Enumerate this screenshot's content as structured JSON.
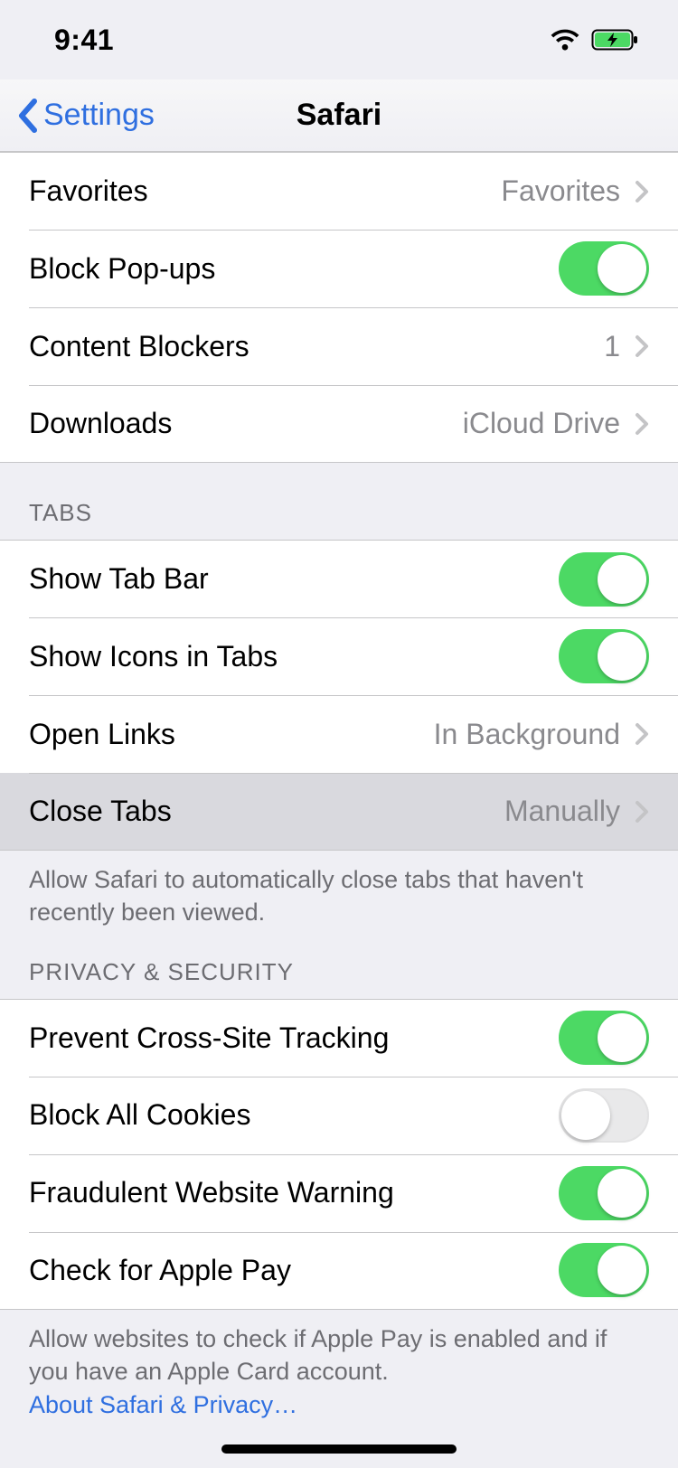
{
  "status": {
    "time": "9:41"
  },
  "nav": {
    "back": "Settings",
    "title": "Safari"
  },
  "general": {
    "favorites": {
      "label": "Favorites",
      "value": "Favorites"
    },
    "block_popups": {
      "label": "Block Pop-ups",
      "on": true
    },
    "content_blockers": {
      "label": "Content Blockers",
      "value": "1"
    },
    "downloads": {
      "label": "Downloads",
      "value": "iCloud Drive"
    }
  },
  "tabs": {
    "header": "TABS",
    "show_tab_bar": {
      "label": "Show Tab Bar",
      "on": true
    },
    "show_icons": {
      "label": "Show Icons in Tabs",
      "on": true
    },
    "open_links": {
      "label": "Open Links",
      "value": "In Background"
    },
    "close_tabs": {
      "label": "Close Tabs",
      "value": "Manually"
    },
    "footer": "Allow Safari to automatically close tabs that haven't recently been viewed."
  },
  "privacy": {
    "header": "PRIVACY & SECURITY",
    "prevent_tracking": {
      "label": "Prevent Cross-Site Tracking",
      "on": true
    },
    "block_cookies": {
      "label": "Block All Cookies",
      "on": false
    },
    "fraud_warning": {
      "label": "Fraudulent Website Warning",
      "on": true
    },
    "apple_pay": {
      "label": "Check for Apple Pay",
      "on": true
    },
    "footer": "Allow websites to check if Apple Pay is enabled and if you have an Apple Card account.",
    "link": "About Safari & Privacy…"
  }
}
